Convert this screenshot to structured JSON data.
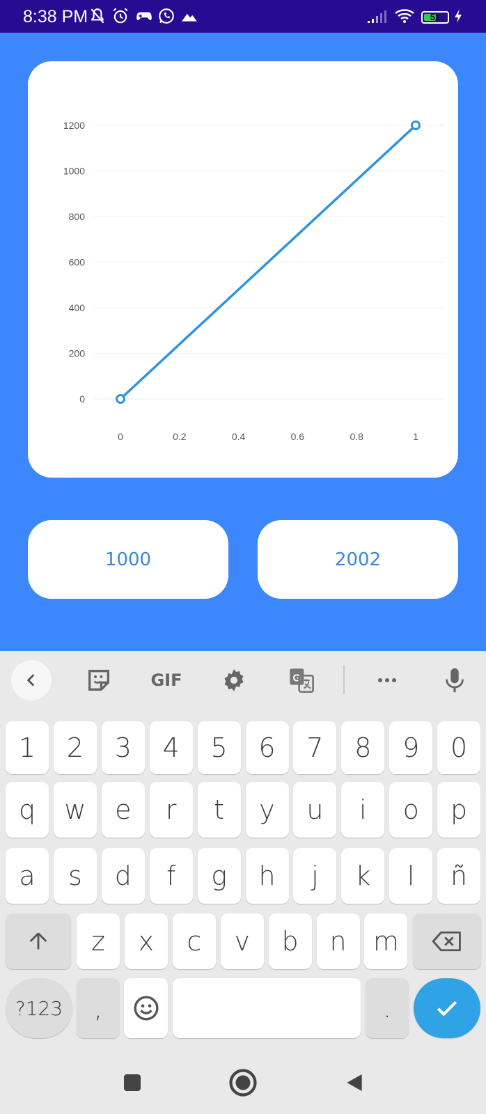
{
  "status_bar": {
    "time": "8:38 PM",
    "battery_level": "52",
    "icons": [
      "bell-off-icon",
      "alarm-icon",
      "game-controller-icon",
      "whatsapp-icon",
      "mountain-icon",
      "signal-icon",
      "wifi-icon",
      "battery-icon",
      "charging-icon"
    ]
  },
  "chart_data": {
    "type": "line",
    "x": [
      0,
      1
    ],
    "y": [
      0,
      1200
    ],
    "x_ticks": [
      "0",
      "0.2",
      "0.4",
      "0.6",
      "0.8",
      "1"
    ],
    "y_ticks": [
      "0",
      "200",
      "400",
      "600",
      "800",
      "1000",
      "1200"
    ],
    "xlim": [
      0,
      1
    ],
    "ylim": [
      0,
      1200
    ],
    "grid": true,
    "line_color": "#2E93DE",
    "title": "",
    "xlabel": "",
    "ylabel": ""
  },
  "buttons": {
    "left_value": "1000",
    "right_value": "2002"
  },
  "keyboard": {
    "toolbar": [
      "back-icon",
      "sticker-icon",
      "GIF",
      "gear-icon",
      "translate-icon",
      "more-icon",
      "microphone-icon"
    ],
    "gif_label": "GIF",
    "number_row": [
      "1",
      "2",
      "3",
      "4",
      "5",
      "6",
      "7",
      "8",
      "9",
      "0"
    ],
    "row1": [
      "q",
      "w",
      "e",
      "r",
      "t",
      "y",
      "u",
      "i",
      "o",
      "p"
    ],
    "row2": [
      "a",
      "s",
      "d",
      "f",
      "g",
      "h",
      "j",
      "k",
      "l",
      "ñ"
    ],
    "row3": [
      "z",
      "x",
      "c",
      "v",
      "b",
      "n",
      "m"
    ],
    "symbols_label": "?123",
    "comma": ",",
    "period": ".",
    "accent_color": "#2FA3E6"
  },
  "navigation": [
    "recents-icon",
    "home-icon",
    "back-nav-icon"
  ]
}
